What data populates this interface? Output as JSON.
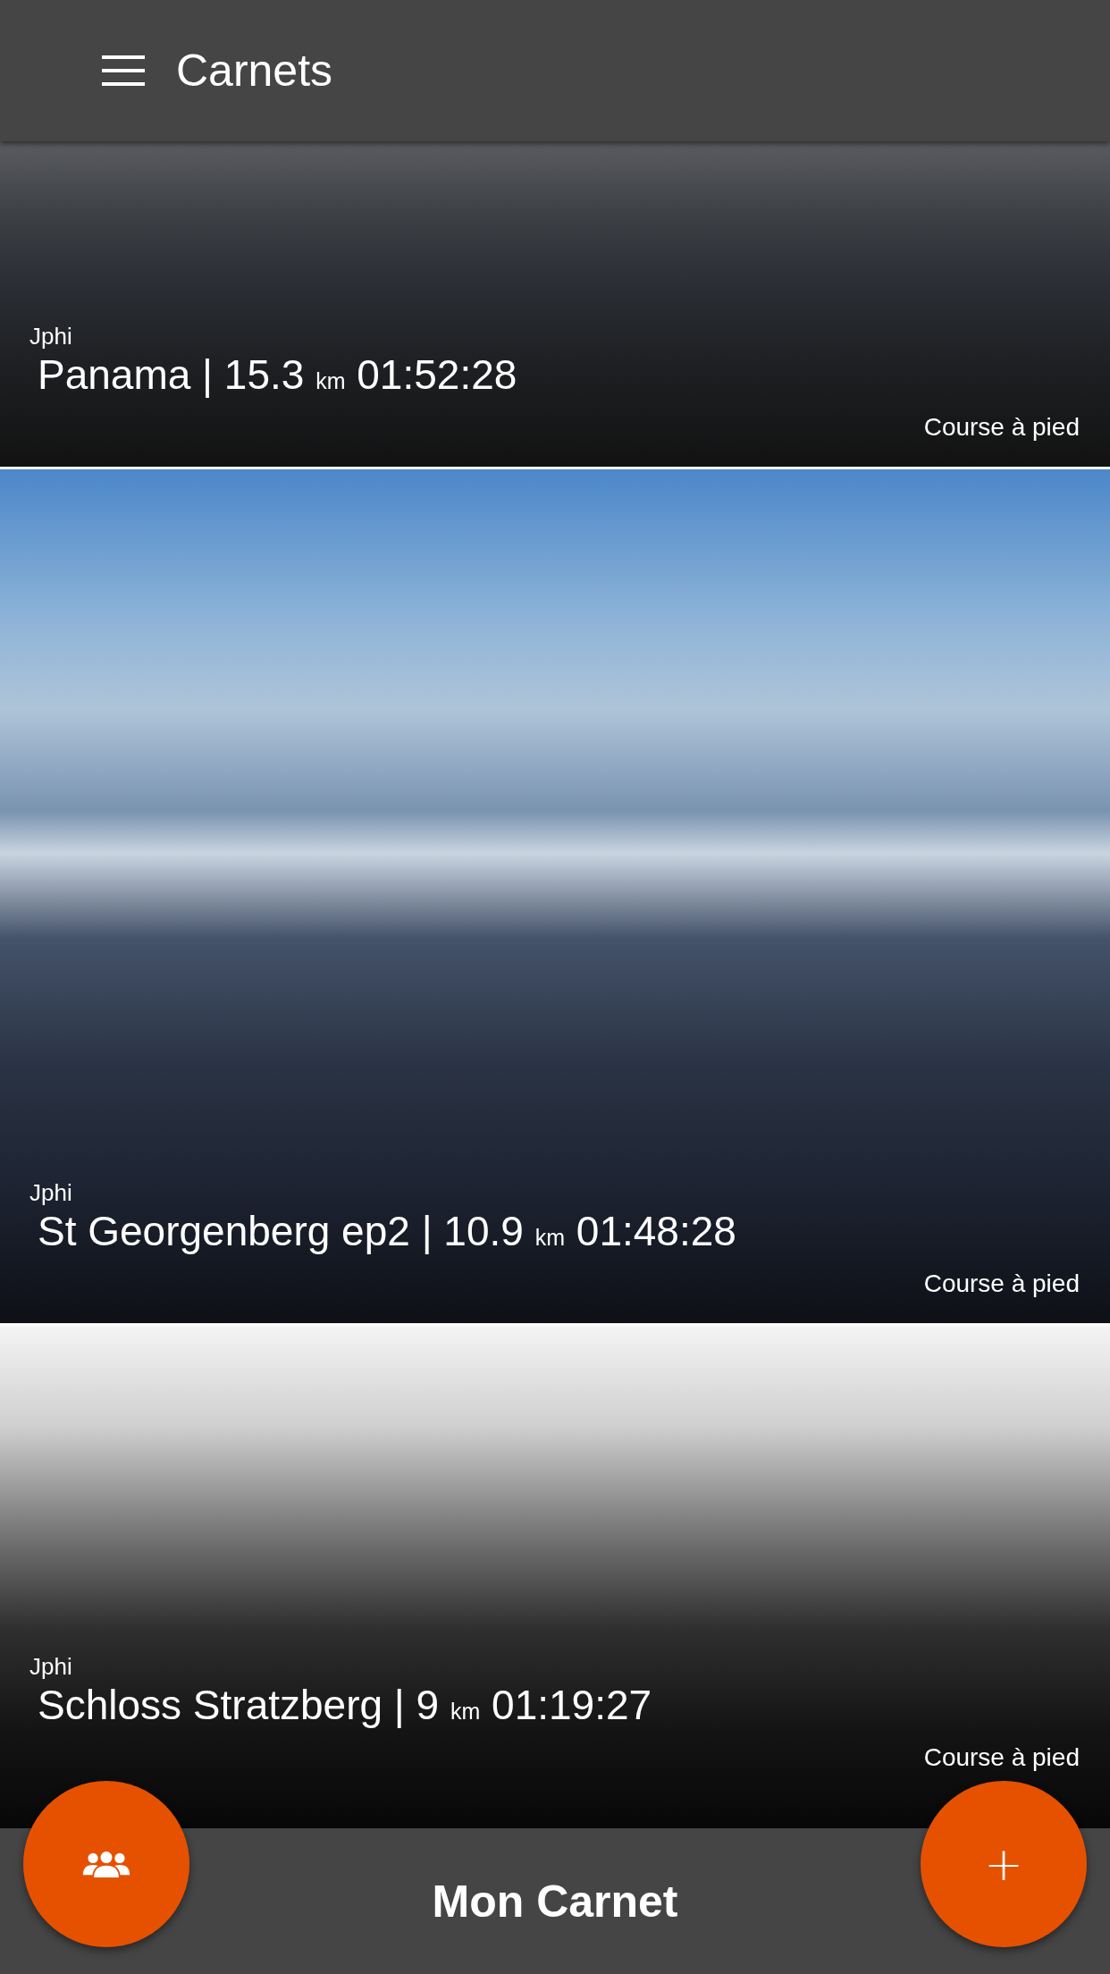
{
  "app_bar": {
    "title": "Carnets"
  },
  "entries": [
    {
      "author": "Jphi",
      "title": "Panama | 15.3",
      "unit": "km",
      "time": "01:52:28",
      "sport": "Course à pied"
    },
    {
      "author": "Jphi",
      "title": "St Georgenberg ep2 | 10.9",
      "unit": "km",
      "time": "01:48:28",
      "sport": "Course à pied"
    },
    {
      "author": "Jphi",
      "title": "Schloss Stratzberg | 9",
      "unit": "km",
      "time": "01:19:27",
      "sport": "Course à pied"
    }
  ],
  "bottom_bar": {
    "label": "Mon Carnet"
  },
  "fab_add": {
    "label": "+"
  }
}
